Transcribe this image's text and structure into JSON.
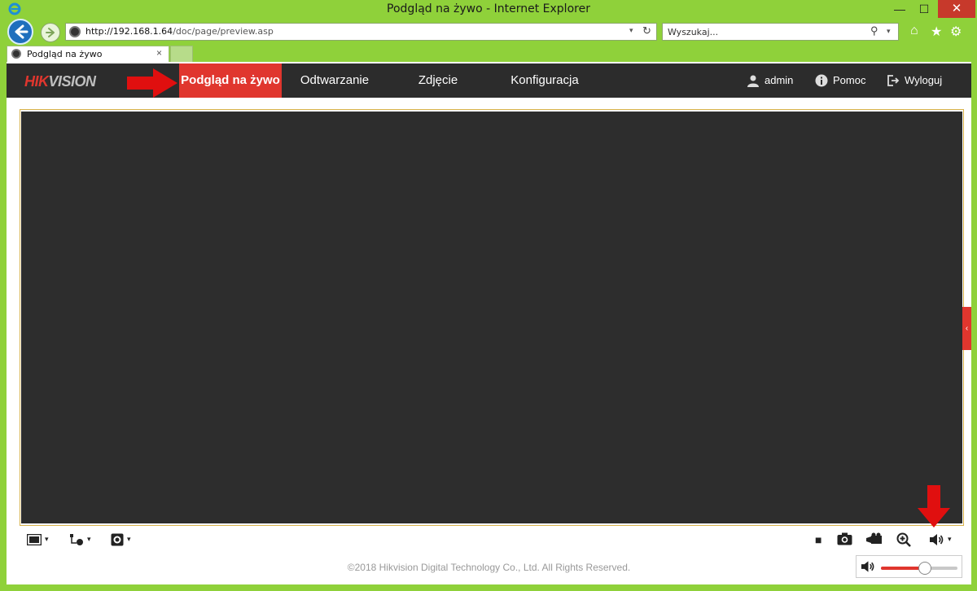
{
  "window": {
    "title": "Podgląd na żywo - Internet Explorer",
    "min_glyph": "—",
    "max_glyph": "☐",
    "close_glyph": "✕"
  },
  "browser": {
    "url_host": "http://192.168.1.64",
    "url_path": "/doc/page/preview.asp",
    "search_placeholder": "Wyszukaj...",
    "tab_label": "Podgląd na żywo",
    "tab_close": "×",
    "refresh_glyph": "↻",
    "drop_glyph": "▾",
    "search_glyph": "⚲",
    "home_glyph": "⌂",
    "star_glyph": "★",
    "gear_glyph": "⚙"
  },
  "app": {
    "logo_brand": "HIK",
    "logo_rest": "VISION",
    "menu": {
      "live": "Podgląd na żywo",
      "playback": "Odtwarzanie",
      "picture": "Zdjęcie",
      "config": "Konfiguracja"
    },
    "user": {
      "name": "admin",
      "help": "Pomoc",
      "logout": "Wyloguj"
    },
    "side_tab_glyph": "‹",
    "toolbar": {
      "caret": "▾",
      "stop_glyph": "■",
      "zoom_glyph": "⊕",
      "speaker_glyph": "🔊"
    },
    "footer": "©2018 Hikvision Digital Technology Co., Ltd. All Rights Reserved.",
    "volume": {
      "level": 0.57,
      "icon": "🔊"
    }
  },
  "colors": {
    "accent": "#e0362e",
    "frame": "#8fd13a",
    "appbar": "#2c2c2c"
  }
}
